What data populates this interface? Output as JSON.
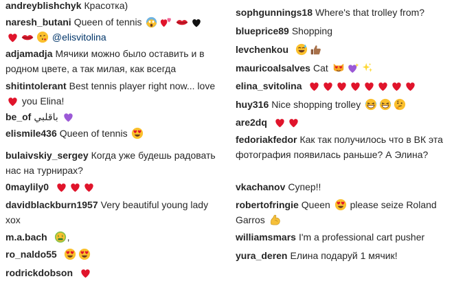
{
  "left_comments": [
    {
      "user": "andreyblishchyk",
      "text": "Красотка)",
      "emoji": []
    },
    {
      "user": "naresh_butani",
      "text": "Queen of tennis",
      "emoji": [
        "scream-face",
        "two-hearts",
        "kiss-lips",
        "black-heart",
        "red-heart",
        "kiss-lips",
        "kissing-face"
      ],
      "mention": "@elisvitolina"
    },
    {
      "user": "adjamadja",
      "text": "Мячики можно было оставить и в родном цвете, а так милая, как всегда",
      "emoji": []
    },
    {
      "user": "shitintolerant",
      "text": "Best tennis player right now... love",
      "emoji": [
        "red-heart"
      ],
      "text_after": "you Elina!"
    },
    {
      "user": "be_of",
      "text": "باقلبي",
      "emoji": [
        "purple-heart"
      ]
    },
    {
      "user": "elismile436",
      "text": "Queen of tennis",
      "emoji": [
        "heart-eyes-face"
      ]
    },
    {
      "user": "bulaivskiy_sergey",
      "text": "Когда уже будешь радовать нас на турнирах?",
      "emoji": []
    },
    {
      "user": "0maylily0",
      "text": "",
      "emoji": [
        "red-heart",
        "red-heart",
        "red-heart"
      ]
    },
    {
      "user": "davidblackburn1957",
      "text": "Very beautiful young lady xox",
      "emoji": []
    },
    {
      "user": "m.a.bach",
      "text": ",",
      "emoji": [
        "money-mouth-face"
      ]
    },
    {
      "user": "ro_naldo55",
      "text": "",
      "emoji": [
        "heart-eyes-face",
        "heart-eyes-face"
      ]
    },
    {
      "user": "rodrickdobson",
      "text": "",
      "emoji": [
        "red-heart"
      ]
    }
  ],
  "right_comments": [
    {
      "user": "sophgunnings18",
      "text": "Where's that trolley from?",
      "emoji": []
    },
    {
      "user": "blueprice89",
      "text": "Shopping",
      "emoji": []
    },
    {
      "user": "levchenkou",
      "text": "",
      "emoji": [
        "sweat-smile-face",
        "thumbs-up"
      ]
    },
    {
      "user": "mauricoalsalves",
      "text": "Cat",
      "emoji": [
        "heart-eyes-cat",
        "sparkling-heart",
        "sparkles"
      ]
    },
    {
      "user": "elina_svitolina",
      "text": "",
      "emoji": [
        "red-heart",
        "red-heart",
        "red-heart",
        "red-heart",
        "red-heart",
        "red-heart",
        "red-heart",
        "red-heart"
      ]
    },
    {
      "user": "huy316",
      "text": "Nice shopping trolley",
      "emoji": [
        "grinning-sweat-face",
        "grinning-sweat-face",
        "thinking-face"
      ]
    },
    {
      "user": "are2dq",
      "text": "",
      "emoji": [
        "red-heart",
        "red-heart"
      ]
    },
    {
      "user": "fedoriakfedor",
      "text": "Как так получилось что в ВК эта фотография появилась раньше? А Элина?",
      "emoji": []
    },
    {
      "user": "vkachanov",
      "text": "Супер!!",
      "emoji": []
    },
    {
      "user": "robertofringie",
      "text": "Queen",
      "emoji": [
        "heart-eyes-face"
      ],
      "text_after": "please seize Roland Garros",
      "emoji_after": [
        "flexed-bicep"
      ]
    },
    {
      "user": "williamsmars",
      "text": "I'm a professional cart pusher",
      "emoji": []
    },
    {
      "user": "yura_deren",
      "text": "Елина подаруй 1 мячик!",
      "emoji": []
    }
  ],
  "colors": {
    "text": "#262626",
    "mention": "#003569",
    "heart": "#e0142b",
    "emoji_face": "#fbc02d"
  }
}
